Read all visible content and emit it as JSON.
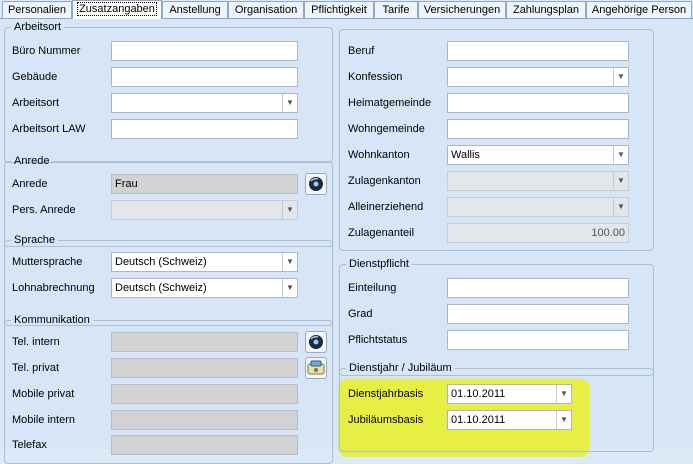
{
  "tabs": [
    {
      "label": "Personalien"
    },
    {
      "label": "Zusatzangaben"
    },
    {
      "label": "Anstellung"
    },
    {
      "label": "Organisation"
    },
    {
      "label": "Pflichtigkeit"
    },
    {
      "label": "Tarife"
    },
    {
      "label": "Versicherungen"
    },
    {
      "label": "Zahlungsplan"
    },
    {
      "label": "Angehörige Person"
    }
  ],
  "arbeitsort": {
    "legend": "Arbeitsort",
    "buero_label": "Büro Nummer",
    "buero_value": "",
    "gebaeude_label": "Gebäude",
    "gebaeude_value": "",
    "arbeitsort_label": "Arbeitsort",
    "arbeitsort_value": "",
    "law_label": "Arbeitsort LAW",
    "law_value": ""
  },
  "anrede": {
    "legend": "Anrede",
    "anrede_label": "Anrede",
    "anrede_value": "Frau",
    "pers_label": "Pers. Anrede",
    "pers_value": ""
  },
  "sprache": {
    "legend": "Sprache",
    "mutter_label": "Muttersprache",
    "mutter_value": "Deutsch (Schweiz)",
    "lohn_label": "Lohnabrechnung",
    "lohn_value": "Deutsch (Schweiz)"
  },
  "kommunikation": {
    "legend": "Kommunikation",
    "tel_intern_label": "Tel. intern",
    "tel_privat_label": "Tel. privat",
    "mobile_privat_label": "Mobile privat",
    "mobile_intern_label": "Mobile intern",
    "telefax_label": "Telefax"
  },
  "right": {
    "beruf_label": "Beruf",
    "konfession_label": "Konfession",
    "heimat_label": "Heimatgemeinde",
    "wohn_label": "Wohngemeinde",
    "kanton_label": "Wohnkanton",
    "kanton_value": "Wallis",
    "zulagenkanton_label": "Zulagenkanton",
    "allein_label": "Alleinerziehend",
    "zulagenanteil_label": "Zulagenanteil",
    "zulagenanteil_value": "100.00"
  },
  "dienstpflicht": {
    "legend": "Dienstpflicht",
    "einteilung_label": "Einteilung",
    "grad_label": "Grad",
    "status_label": "Pflichtstatus"
  },
  "jubilaeum": {
    "legend": "Dienstjahr / Jubiläum",
    "dienst_label": "Dienstjahrbasis",
    "dienst_value": "01.10.2011",
    "jub_label": "Jubiläumsbasis",
    "jub_value": "01.10.2011"
  },
  "colors": {
    "highlight": "#e8ef3a",
    "panel": "#d6e6f6",
    "readonly": "#d2d2d2"
  }
}
